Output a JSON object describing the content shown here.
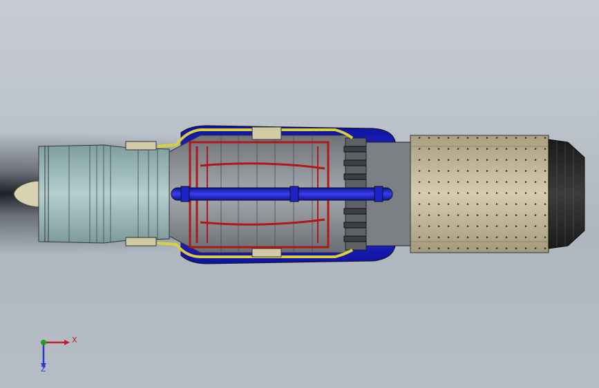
{
  "viewport": {
    "background_top": "#c7ccd3",
    "background_bottom": "#aeb6c0"
  },
  "model": {
    "name": "jet-engine-assembly",
    "colors": {
      "nose_cone": "#d9d2b0",
      "compressor_casing": "#9fbcbc",
      "combustor_casing": "#8e9196",
      "fuel_rails": "#b01818",
      "bleed_pipes": "#d8cf3a",
      "manifold": "#1c22c8",
      "exhaust_liner": "#c8c0a0",
      "nozzle": "#2a2a2a"
    },
    "icons": [
      "nose-cone",
      "compressor",
      "combustor",
      "turbine",
      "exhaust-duct",
      "nozzle"
    ]
  },
  "triad": {
    "x_label": "X",
    "z_label": "Z",
    "x_color": "#c0202a",
    "y_color": "#20a020",
    "z_color": "#2a3cbf"
  }
}
